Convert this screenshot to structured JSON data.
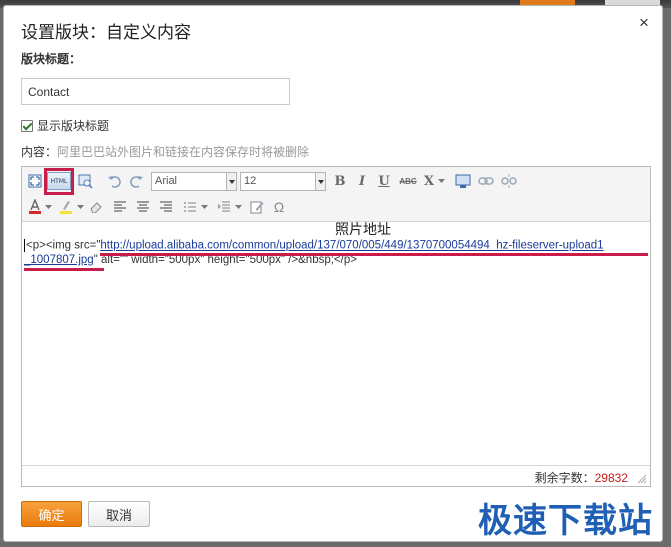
{
  "dialog": {
    "title": "设置版块：自定义内容",
    "close_glyph": "×"
  },
  "form": {
    "title_label": "版块标题：",
    "title_value": "Contact",
    "show_title_label": "显示版块标题",
    "show_title_checked": true,
    "content_label": "内容：",
    "content_hint": "阿里巴巴站外图片和链接在内容保存时将被删除"
  },
  "toolbar": {
    "html_label": "HTML",
    "font_name": "Arial",
    "font_size": "12",
    "bold": "B",
    "italic": "I",
    "underline": "U",
    "strike": "ABC",
    "superscript": "X",
    "omega": "Ω",
    "icons": [
      "fullscreen-icon",
      "html-source-icon",
      "preview-icon",
      "undo-icon",
      "redo-icon",
      "bold-icon",
      "italic-icon",
      "underline-icon",
      "strikethrough-icon",
      "superscript-icon",
      "image-icon",
      "link-icon",
      "unlink-icon",
      "font-color-icon",
      "highlight-icon",
      "eraser-icon",
      "align-left-icon",
      "align-center-icon",
      "align-right-icon",
      "list-icon",
      "indent-icon",
      "edit-icon",
      "special-char-icon"
    ]
  },
  "editor": {
    "annotation": "照片地址",
    "code_prefix": "<p><img src=\"",
    "url_part1": "http://upload.alibaba.com/common/upload/137/070/005/449/1370700054494_hz-fileserver-upload1",
    "url_part2": "_1007807.jpg",
    "code_suffix": "\" alt=\"\" width=\"500px\" height=\"500px\" />&nbsp;</p>",
    "chars_left_label": "剩余字数：",
    "chars_left_value": "29832"
  },
  "buttons": {
    "ok": "确定",
    "cancel": "取消"
  },
  "watermark": "极速下载站",
  "colors": {
    "accent_orange": "#e97b0d",
    "annotation_red": "#c81d4a",
    "count_red": "#c81d1d",
    "watermark_blue": "#1f5fb4"
  }
}
